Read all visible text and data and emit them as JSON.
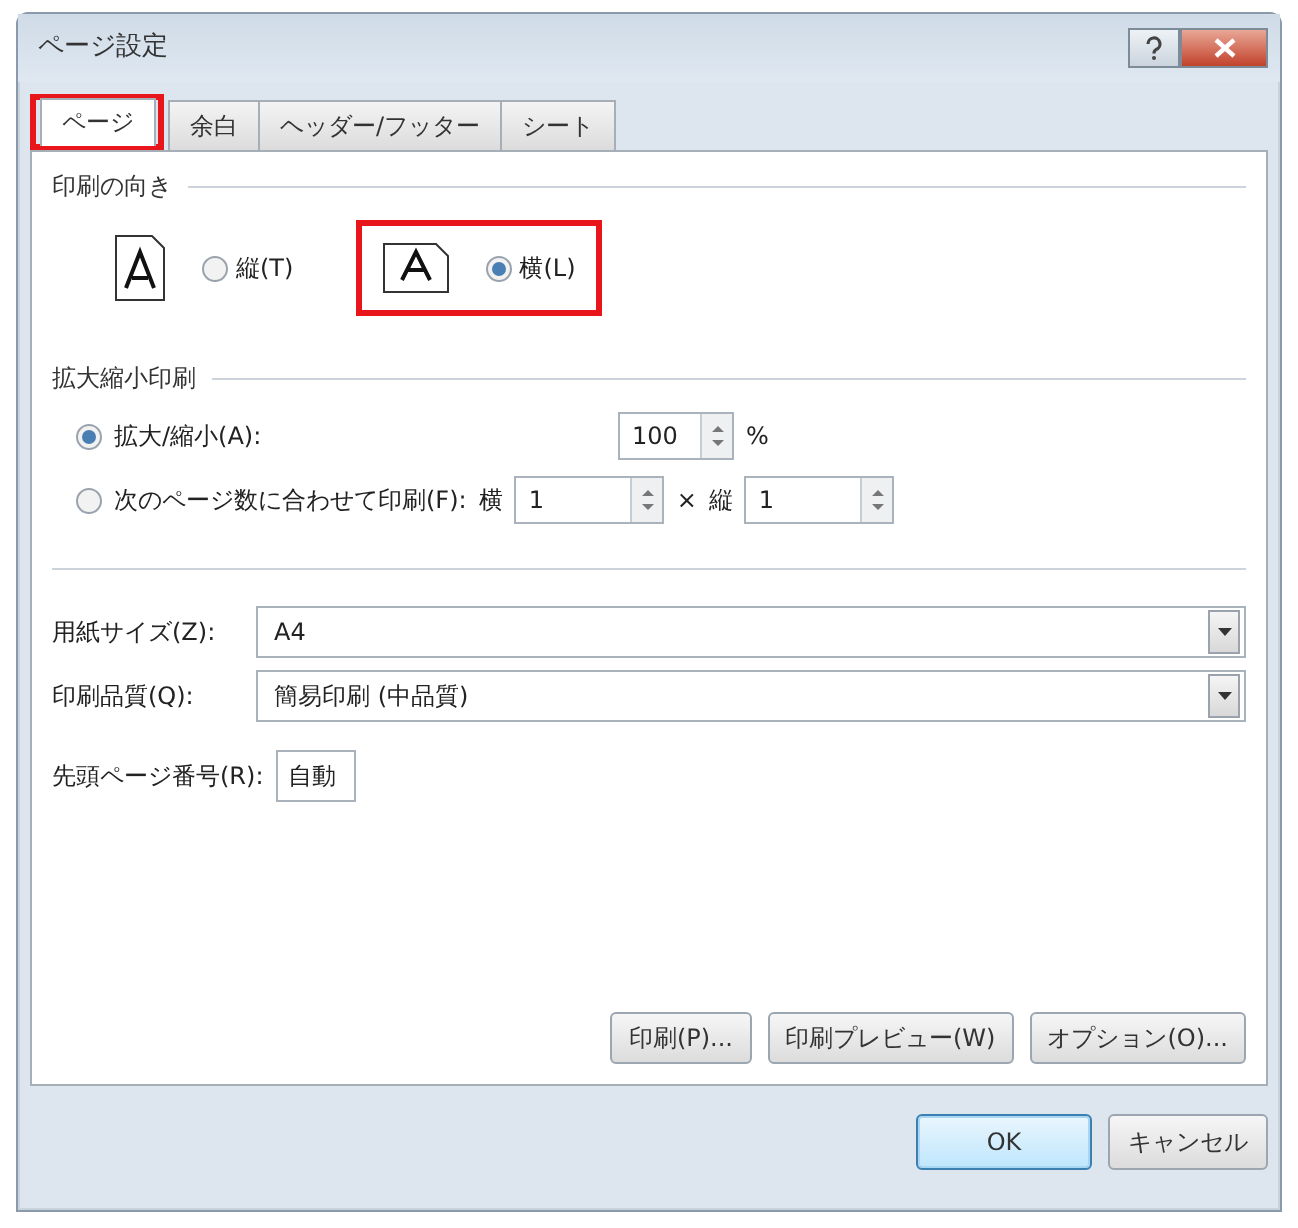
{
  "window": {
    "title": "ページ設定"
  },
  "tabs": [
    {
      "label": "ページ",
      "selected": true,
      "highlighted": true
    },
    {
      "label": "余白",
      "selected": false,
      "highlighted": false
    },
    {
      "label": "ヘッダー/フッター",
      "selected": false,
      "highlighted": false
    },
    {
      "label": "シート",
      "selected": false,
      "highlighted": false
    }
  ],
  "orientation": {
    "heading": "印刷の向き",
    "options": [
      {
        "kind": "portrait",
        "label": "縦(T)",
        "selected": false,
        "highlighted": false
      },
      {
        "kind": "landscape",
        "label": "横(L)",
        "selected": true,
        "highlighted": true
      }
    ]
  },
  "scaling": {
    "heading": "拡大縮小印刷",
    "percent": {
      "label": "拡大/縮小(A):",
      "selected": true,
      "value": "100",
      "unit": "%"
    },
    "fit": {
      "label": "次のページ数に合わせて印刷(F):",
      "selected": false,
      "wide_label": "横",
      "wide_value": "1",
      "times": "×",
      "tall_label": "縦",
      "tall_value": "1"
    }
  },
  "paper_size": {
    "label": "用紙サイズ(Z):",
    "value": "A4"
  },
  "print_quality": {
    "label": "印刷品質(Q):",
    "value": "簡易印刷 (中品質)"
  },
  "first_page_number": {
    "label": "先頭ページ番号(R):",
    "value": "自動"
  },
  "panel_buttons": [
    "印刷(P)...",
    "印刷プレビュー(W)",
    "オプション(O)..."
  ],
  "dialog_buttons": [
    {
      "label": "OK",
      "default": true
    },
    {
      "label": "キャンセル",
      "default": false
    }
  ]
}
